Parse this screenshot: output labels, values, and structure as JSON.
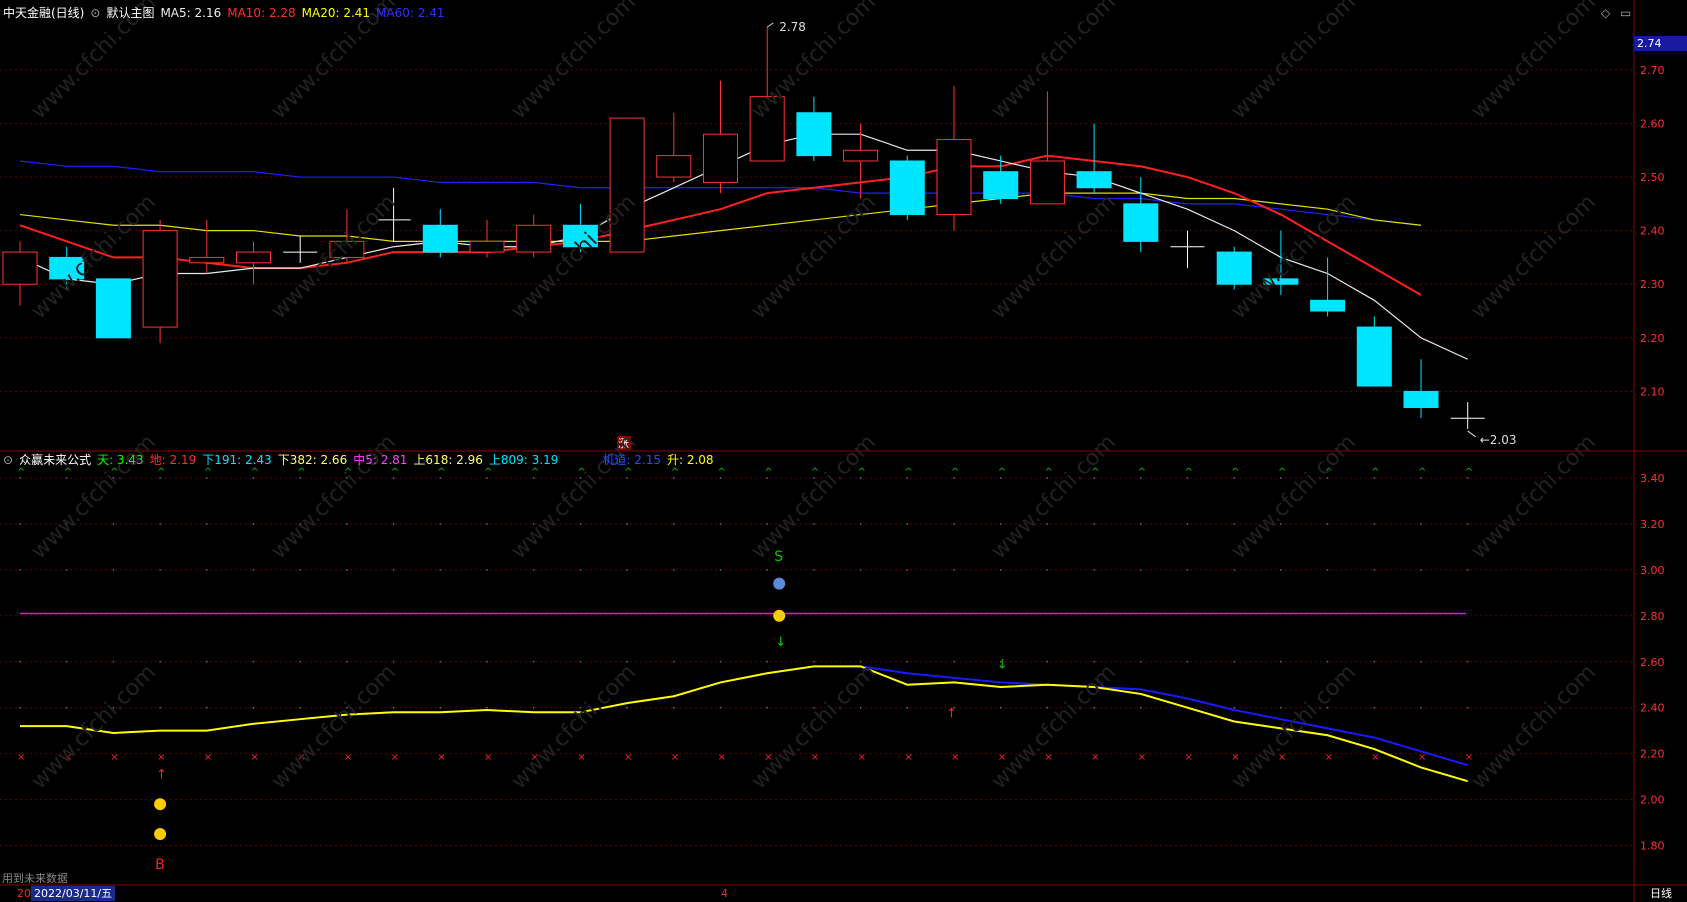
{
  "header_top": {
    "title": "中天金融(日线)",
    "main_label": "默认主图",
    "ma5": "MA5: 2.16",
    "ma10": "MA10: 2.28",
    "ma20": "MA20: 2.41",
    "ma60": "MA60: 2.41"
  },
  "header_bottom": {
    "formula": "众赢未来公式",
    "tian": "天: 3.43",
    "di": "地: 2.19",
    "x191": "下191: 2.43",
    "x382": "下382: 2.66",
    "z5": "中5: 2.81",
    "s618": "上618: 2.96",
    "s809": "上809: 3.19",
    "qiangshi": "机道: 2.15",
    "sheng": "升: 2.08"
  },
  "toolbar": {
    "diamond": "◇",
    "window": "▭"
  },
  "price_tag": "2.74",
  "high_label": "2.78",
  "low_label": "2.03",
  "zhang_badge": "涨",
  "footer": {
    "left_prefix": "20",
    "date": "2022/03/11/五",
    "mid_marker": "4",
    "period": "日线",
    "note": "用到未来数据"
  },
  "colors": {
    "up": "#ff3333",
    "down": "#00e5ff",
    "ma5": "#e8e8e8",
    "ma10": "#ff2020",
    "ma20": "#e0e000",
    "ma60": "#2020ff",
    "grid": "#5a0000",
    "magenta": "#ff00ff",
    "yellow": "#ffff00",
    "blue": "#1a1aff"
  },
  "chart_data": [
    {
      "type": "candlestick",
      "title": "中天金融(日线)",
      "ylim": [
        2.0,
        2.78
      ],
      "yticks": [
        "2.70",
        "2.60",
        "2.50",
        "2.40",
        "2.30",
        "2.20",
        "2.10"
      ],
      "candles": [
        {
          "o": 2.3,
          "c": 2.36,
          "h": 2.38,
          "l": 2.26
        },
        {
          "o": 2.35,
          "c": 2.31,
          "h": 2.37,
          "l": 2.29
        },
        {
          "o": 2.31,
          "c": 2.2,
          "h": 2.31,
          "l": 2.2
        },
        {
          "o": 2.22,
          "c": 2.4,
          "h": 2.42,
          "l": 2.19
        },
        {
          "o": 2.34,
          "c": 2.35,
          "h": 2.42,
          "l": 2.32
        },
        {
          "o": 2.34,
          "c": 2.36,
          "h": 2.38,
          "l": 2.3
        },
        {
          "o": 2.36,
          "c": 2.36,
          "h": 2.39,
          "l": 2.34
        },
        {
          "o": 2.35,
          "c": 2.38,
          "h": 2.44,
          "l": 2.34
        },
        {
          "o": 2.42,
          "c": 2.42,
          "h": 2.48,
          "l": 2.38
        },
        {
          "o": 2.41,
          "c": 2.36,
          "h": 2.44,
          "l": 2.35
        },
        {
          "o": 2.36,
          "c": 2.38,
          "h": 2.42,
          "l": 2.35
        },
        {
          "o": 2.36,
          "c": 2.41,
          "h": 2.43,
          "l": 2.35
        },
        {
          "o": 2.41,
          "c": 2.37,
          "h": 2.45,
          "l": 2.36
        },
        {
          "o": 2.36,
          "c": 2.61,
          "h": 2.61,
          "l": 2.36
        },
        {
          "o": 2.5,
          "c": 2.54,
          "h": 2.62,
          "l": 2.49
        },
        {
          "o": 2.49,
          "c": 2.58,
          "h": 2.68,
          "l": 2.47
        },
        {
          "o": 2.53,
          "c": 2.65,
          "h": 2.78,
          "l": 2.53
        },
        {
          "o": 2.62,
          "c": 2.54,
          "h": 2.65,
          "l": 2.53
        },
        {
          "o": 2.53,
          "c": 2.55,
          "h": 2.6,
          "l": 2.46
        },
        {
          "o": 2.53,
          "c": 2.43,
          "h": 2.54,
          "l": 2.42
        },
        {
          "o": 2.43,
          "c": 2.57,
          "h": 2.67,
          "l": 2.4
        },
        {
          "o": 2.51,
          "c": 2.46,
          "h": 2.54,
          "l": 2.45
        },
        {
          "o": 2.45,
          "c": 2.53,
          "h": 2.66,
          "l": 2.45
        },
        {
          "o": 2.51,
          "c": 2.48,
          "h": 2.6,
          "l": 2.47
        },
        {
          "o": 2.45,
          "c": 2.38,
          "h": 2.5,
          "l": 2.36
        },
        {
          "o": 2.37,
          "c": 2.37,
          "h": 2.4,
          "l": 2.33
        },
        {
          "o": 2.36,
          "c": 2.3,
          "h": 2.37,
          "l": 2.29
        },
        {
          "o": 2.31,
          "c": 2.3,
          "h": 2.4,
          "l": 2.28
        },
        {
          "o": 2.27,
          "c": 2.25,
          "h": 2.35,
          "l": 2.24
        },
        {
          "o": 2.22,
          "c": 2.11,
          "h": 2.24,
          "l": 2.11
        },
        {
          "o": 2.1,
          "c": 2.07,
          "h": 2.16,
          "l": 2.05
        },
        {
          "o": 2.05,
          "c": 2.05,
          "h": 2.08,
          "l": 2.03
        }
      ],
      "ma5": [
        2.35,
        2.31,
        2.3,
        2.32,
        2.32,
        2.33,
        2.33,
        2.35,
        2.37,
        2.38,
        2.37,
        2.37,
        2.39,
        2.44,
        2.48,
        2.52,
        2.56,
        2.58,
        2.58,
        2.55,
        2.55,
        2.53,
        2.51,
        2.5,
        2.47,
        2.44,
        2.4,
        2.35,
        2.32,
        2.27,
        2.2,
        2.16
      ],
      "ma10": [
        2.41,
        2.38,
        2.35,
        2.35,
        2.34,
        2.33,
        2.33,
        2.34,
        2.36,
        2.36,
        2.36,
        2.37,
        2.38,
        2.4,
        2.42,
        2.44,
        2.47,
        2.48,
        2.49,
        2.5,
        2.52,
        2.52,
        2.54,
        2.53,
        2.52,
        2.5,
        2.47,
        2.43,
        2.38,
        2.33,
        2.28
      ],
      "ma20": [
        2.43,
        2.42,
        2.41,
        2.41,
        2.4,
        2.4,
        2.39,
        2.39,
        2.38,
        2.38,
        2.38,
        2.38,
        2.38,
        2.38,
        2.39,
        2.4,
        2.41,
        2.42,
        2.43,
        2.44,
        2.45,
        2.46,
        2.47,
        2.47,
        2.47,
        2.46,
        2.46,
        2.45,
        2.44,
        2.42,
        2.41
      ],
      "ma60": [
        2.53,
        2.52,
        2.52,
        2.51,
        2.51,
        2.51,
        2.5,
        2.5,
        2.5,
        2.49,
        2.49,
        2.49,
        2.48,
        2.48,
        2.48,
        2.48,
        2.48,
        2.48,
        2.47,
        2.47,
        2.47,
        2.47,
        2.47,
        2.46,
        2.46,
        2.45,
        2.45,
        2.44,
        2.43,
        2.42,
        2.41
      ]
    },
    {
      "type": "line",
      "title": "众赢未来公式",
      "ylim": [
        1.65,
        3.5
      ],
      "yticks": [
        "3.40",
        "3.20",
        "3.00",
        "2.80",
        "2.60",
        "2.40",
        "2.20",
        "2.00",
        "1.80"
      ],
      "hline": 2.81,
      "series": [
        {
          "name": "升",
          "values": [
            2.32,
            2.32,
            2.29,
            2.3,
            2.3,
            2.33,
            2.35,
            2.37,
            2.38,
            2.38,
            2.39,
            2.38,
            2.38,
            2.42,
            2.45,
            2.51,
            2.55,
            2.58,
            2.58,
            2.5,
            2.51,
            2.49,
            2.5,
            2.49,
            2.46,
            2.4,
            2.34,
            2.31,
            2.28,
            2.22,
            2.14,
            2.08
          ]
        },
        {
          "name": "机道",
          "values": [
            null,
            null,
            null,
            null,
            null,
            null,
            null,
            null,
            null,
            null,
            null,
            null,
            null,
            null,
            null,
            null,
            null,
            null,
            2.58,
            2.55,
            2.53,
            2.51,
            2.5,
            2.49,
            2.48,
            2.44,
            2.39,
            2.35,
            2.31,
            2.27,
            2.21,
            2.15
          ]
        }
      ]
    }
  ]
}
